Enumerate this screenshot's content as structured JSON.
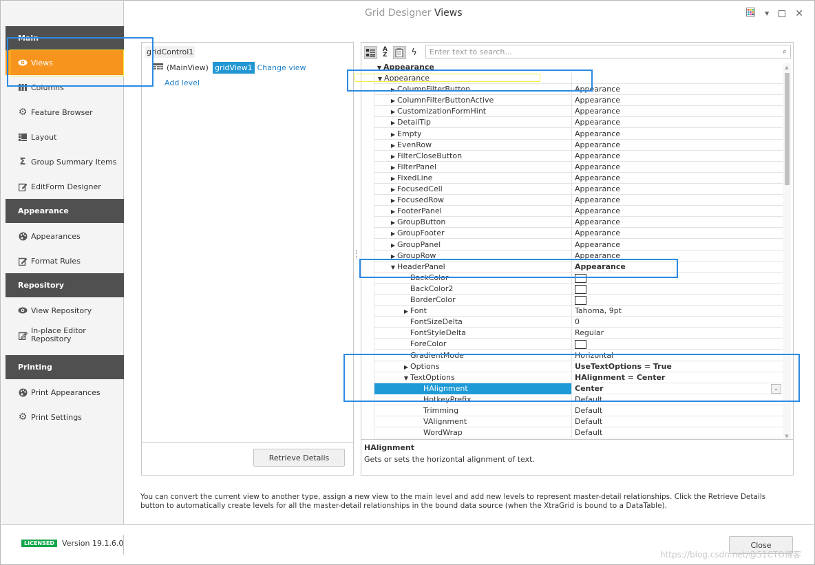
{
  "window": {
    "title_prefix": "Grid Designer",
    "title_main": "Views",
    "controls": [
      "palette-icon",
      "dropdown-arrow-icon",
      "maximize-icon",
      "close-icon"
    ]
  },
  "sidebar": {
    "groups": [
      {
        "label": "Main",
        "items": [
          {
            "label": "Views",
            "icon": "eye-icon",
            "active": true
          },
          {
            "label": "Columns",
            "icon": "columns-icon"
          },
          {
            "label": "Feature Browser",
            "icon": "gear-icon"
          },
          {
            "label": "Layout",
            "icon": "layout-icon"
          },
          {
            "label": "Group Summary Items",
            "icon": "sigma-icon"
          },
          {
            "label": "EditForm Designer",
            "icon": "edit-form-icon"
          }
        ]
      },
      {
        "label": "Appearance",
        "items": [
          {
            "label": "Appearances",
            "icon": "palette-icon"
          },
          {
            "label": "Format Rules",
            "icon": "format-rules-icon"
          }
        ]
      },
      {
        "label": "Repository",
        "items": [
          {
            "label": "View Repository",
            "icon": "eye-icon"
          },
          {
            "label": "In-place Editor Repository",
            "line1": "In-place Editor",
            "line2": "Repository",
            "icon": "edit-icon"
          }
        ]
      },
      {
        "label": "Printing",
        "items": [
          {
            "label": "Print Appearances",
            "icon": "palette-icon"
          },
          {
            "label": "Print Settings",
            "icon": "gear-icon"
          }
        ]
      }
    ]
  },
  "views_panel": {
    "root": "gridControl1",
    "level_label": "(MainView)",
    "view_name": "gridView1",
    "change_view": "Change view",
    "add_level": "Add level",
    "retrieve_button": "Retrieve Details"
  },
  "property_grid": {
    "search_placeholder": "Enter text to search...",
    "toolbar": [
      "categorized-icon",
      "alphabetical-icon",
      "property-pages-icon",
      "events-icon"
    ],
    "category": "Appearance",
    "rows": [
      {
        "name": "Appearance",
        "value": "",
        "level": 0,
        "expander": "open"
      },
      {
        "name": "ColumnFilterButton",
        "value": "Appearance",
        "level": 1,
        "expander": "closed"
      },
      {
        "name": "ColumnFilterButtonActive",
        "value": "Appearance",
        "level": 1,
        "expander": "closed"
      },
      {
        "name": "CustomizationFormHint",
        "value": "Appearance",
        "level": 1,
        "expander": "closed"
      },
      {
        "name": "DetailTip",
        "value": "Appearance",
        "level": 1,
        "expander": "closed"
      },
      {
        "name": "Empty",
        "value": "Appearance",
        "level": 1,
        "expander": "closed"
      },
      {
        "name": "EvenRow",
        "value": "Appearance",
        "level": 1,
        "expander": "closed"
      },
      {
        "name": "FilterCloseButton",
        "value": "Appearance",
        "level": 1,
        "expander": "closed"
      },
      {
        "name": "FilterPanel",
        "value": "Appearance",
        "level": 1,
        "expander": "closed"
      },
      {
        "name": "FixedLine",
        "value": "Appearance",
        "level": 1,
        "expander": "closed"
      },
      {
        "name": "FocusedCell",
        "value": "Appearance",
        "level": 1,
        "expander": "closed"
      },
      {
        "name": "FocusedRow",
        "value": "Appearance",
        "level": 1,
        "expander": "closed"
      },
      {
        "name": "FooterPanel",
        "value": "Appearance",
        "level": 1,
        "expander": "closed"
      },
      {
        "name": "GroupButton",
        "value": "Appearance",
        "level": 1,
        "expander": "closed"
      },
      {
        "name": "GroupFooter",
        "value": "Appearance",
        "level": 1,
        "expander": "closed"
      },
      {
        "name": "GroupPanel",
        "value": "Appearance",
        "level": 1,
        "expander": "closed"
      },
      {
        "name": "GroupRow",
        "value": "Appearance",
        "level": 1,
        "expander": "closed"
      },
      {
        "name": "HeaderPanel",
        "value": "Appearance",
        "level": 1,
        "expander": "open",
        "bold": true
      },
      {
        "name": "BackColor",
        "value": "",
        "level": 2,
        "swatch": true
      },
      {
        "name": "BackColor2",
        "value": "",
        "level": 2,
        "swatch": true
      },
      {
        "name": "BorderColor",
        "value": "",
        "level": 2,
        "swatch": true
      },
      {
        "name": "Font",
        "value": "Tahoma, 9pt",
        "level": 2,
        "expander": "closed"
      },
      {
        "name": "FontSizeDelta",
        "value": "0",
        "level": 2
      },
      {
        "name": "FontStyleDelta",
        "value": "Regular",
        "level": 2
      },
      {
        "name": "ForeColor",
        "value": "",
        "level": 2,
        "swatch": true
      },
      {
        "name": "GradientMode",
        "value": "Horizontal",
        "level": 2
      },
      {
        "name": "Options",
        "value": "UseTextOptions = True",
        "level": 2,
        "expander": "closed",
        "bold": true
      },
      {
        "name": "TextOptions",
        "value": "HAlignment = Center",
        "level": 2,
        "expander": "open",
        "bold": true
      },
      {
        "name": "HAlignment",
        "value": "Center",
        "level": 3,
        "selected": true,
        "dropdown": true
      },
      {
        "name": "HotkeyPrefix",
        "value": "Default",
        "level": 3
      },
      {
        "name": "Trimming",
        "value": "Default",
        "level": 3
      },
      {
        "name": "VAlignment",
        "value": "Default",
        "level": 3
      },
      {
        "name": "WordWrap",
        "value": "Default",
        "level": 3
      }
    ],
    "description": {
      "title": "HAlignment",
      "text": "Gets or sets the horizontal alignment of text."
    }
  },
  "info_text": "You can convert the current view to another type, assign a new view to the main level and add new levels to represent master-detail relationships. Click the Retrieve Details button to automatically create levels for all the master-detail relationships in the bound data source (when the XtraGrid is bound to a DataTable).",
  "footer": {
    "license_badge": "LICENSED",
    "version": "Version 19.1.6.0",
    "close_button": "Close",
    "watermark": "https://blog.csdn.net/@51CTO博客"
  },
  "colors": {
    "accent": "#f7941e",
    "selection": "#1e9ad6",
    "group_header": "#505050",
    "licensed": "#10a64b",
    "annotation": "#2b8ae2"
  }
}
